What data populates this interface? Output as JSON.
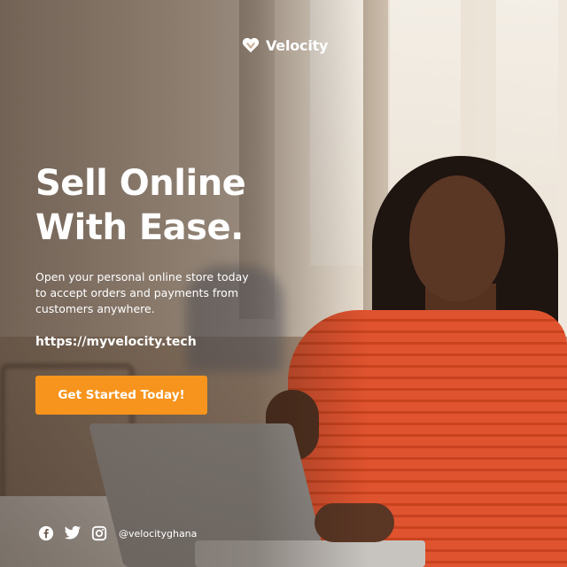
{
  "brand": {
    "name": "Velocity",
    "logo_icon": "heart-v-icon"
  },
  "headline": {
    "line1": "Sell Online",
    "line2": "With Ease."
  },
  "body": {
    "line1": "Open your personal online store today",
    "line2": "to accept orders and payments from",
    "line3": "customers anywhere."
  },
  "url": "https://myvelocity.tech",
  "cta_label": "Get Started Today!",
  "social": {
    "icons": [
      "facebook-icon",
      "twitter-icon",
      "instagram-icon"
    ],
    "handle": "@velocityghana"
  },
  "colors": {
    "accent": "#f7941d",
    "text": "#ffffff",
    "dress": "#e0532f"
  }
}
